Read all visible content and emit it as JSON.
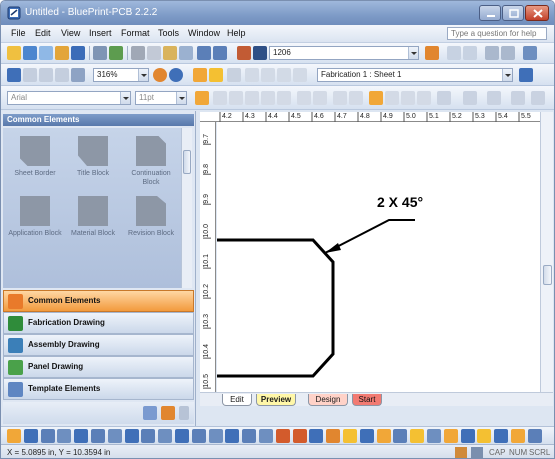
{
  "window": {
    "title": "Untitled - BluePrint-PCB 2.2.2"
  },
  "menu": {
    "items": [
      "File",
      "Edit",
      "View",
      "Insert",
      "Format",
      "Tools",
      "Window",
      "Help"
    ],
    "help_placeholder": "Type a question for help"
  },
  "toolbar1": {
    "zoom_combo": "1206"
  },
  "toolbar2": {
    "zoom": "316%",
    "sheet_selector": "Fabrication 1 : Sheet 1"
  },
  "toolbar3": {
    "font": "Arial",
    "size": "11pt"
  },
  "panel": {
    "header": "Common Elements",
    "shapes": [
      {
        "label": "Sheet Border"
      },
      {
        "label": "Title Block"
      },
      {
        "label": "Continuation Block"
      },
      {
        "label": "Application Block"
      },
      {
        "label": "Material Block"
      },
      {
        "label": "Revision Block"
      }
    ],
    "categories": [
      {
        "label": "Common Elements"
      },
      {
        "label": "Fabrication Drawing"
      },
      {
        "label": "Assembly Drawing"
      },
      {
        "label": "Panel Drawing"
      },
      {
        "label": "Template Elements"
      }
    ]
  },
  "ruler": {
    "top_ticks": [
      "4.2",
      "4.3",
      "4.4",
      "4.5",
      "4.6",
      "4.7",
      "4.8",
      "4.9",
      "5.0",
      "5.1",
      "5.2",
      "5.3",
      "5.4",
      "5.5"
    ],
    "left_ticks": [
      "9.7",
      "9.8",
      "9.9",
      "10.0",
      "10.1",
      "10.2",
      "10.3",
      "10.4",
      "10.5"
    ]
  },
  "drawing": {
    "annotation": "2 X 45°"
  },
  "tabs": [
    "Edit",
    "Preview",
    "Design",
    "Start"
  ],
  "status": {
    "coords": "X = 5.0895 in, Y = 10.3594 in",
    "indicators": [
      "CAP",
      "NUM",
      "SCRL"
    ]
  }
}
